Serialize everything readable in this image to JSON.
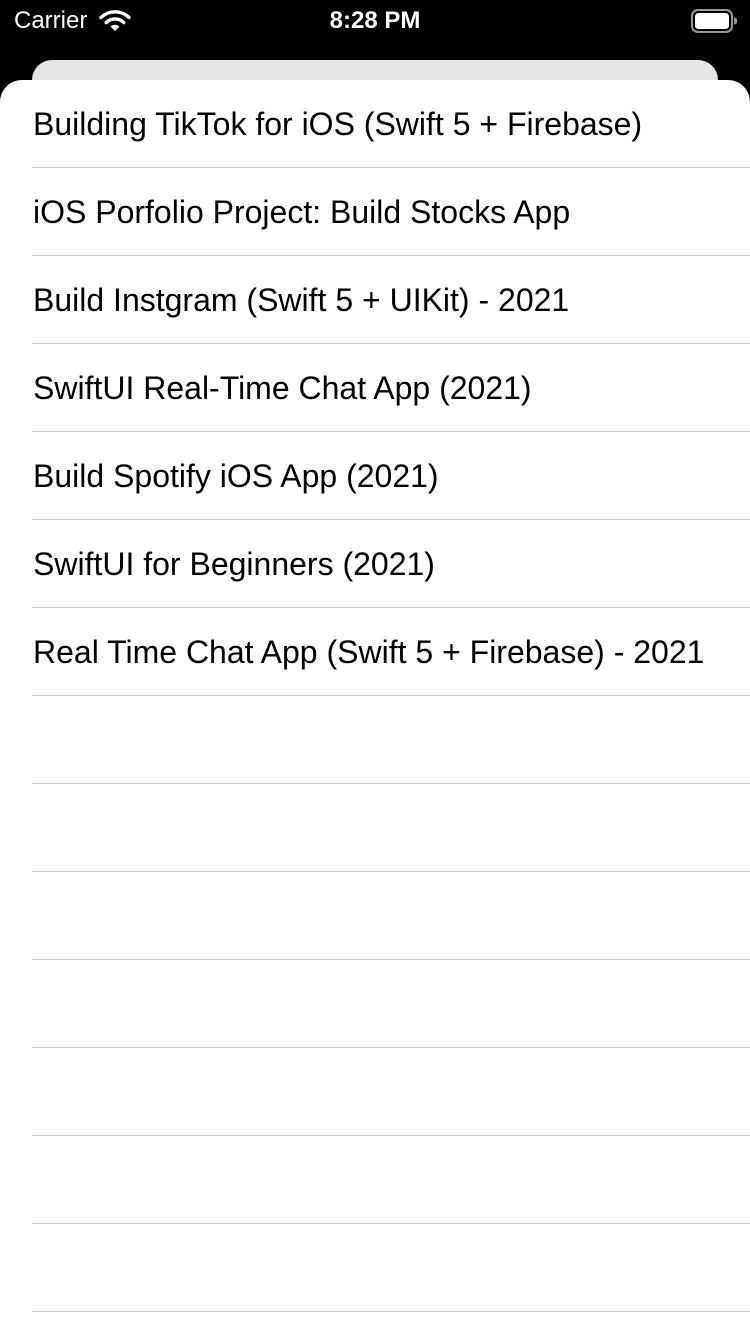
{
  "status_bar": {
    "carrier": "Carrier",
    "time": "8:28 PM",
    "wifi_icon": "wifi-icon",
    "battery_icon": "battery-icon",
    "text_color": "#ffffff"
  },
  "list": {
    "items": [
      {
        "label": "Building TikTok for iOS (Swift 5 + Firebase)"
      },
      {
        "label": "iOS Porfolio Project: Build Stocks App"
      },
      {
        "label": "Build Instgram (Swift 5 + UIKit) - 2021"
      },
      {
        "label": "SwiftUI Real-Time Chat App (2021)"
      },
      {
        "label": "Build Spotify iOS App (2021)"
      },
      {
        "label": "SwiftUI for Beginners (2021)"
      },
      {
        "label": "Real Time Chat App (Swift 5 + Firebase) - 2021"
      }
    ],
    "empty_rows": 7,
    "separator_color": "#c8c7cc"
  }
}
